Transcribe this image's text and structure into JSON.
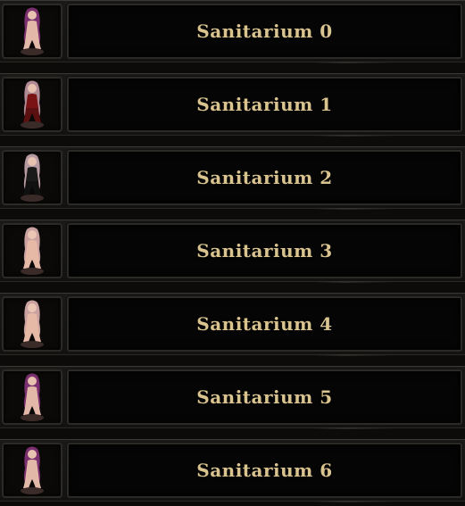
{
  "saves": [
    {
      "label": "Sanitarium 0",
      "portrait_icon": "character-portrait-icon",
      "hair_color": "#7a2f6e",
      "outfit_color": "#e2b8a8"
    },
    {
      "label": "Sanitarium 1",
      "portrait_icon": "character-portrait-icon",
      "hair_color": "#b08a95",
      "outfit_color": "#7a1414"
    },
    {
      "label": "Sanitarium 2",
      "portrait_icon": "character-portrait-icon",
      "hair_color": "#b59aa2",
      "outfit_color": "#1a1a1a"
    },
    {
      "label": "Sanitarium 3",
      "portrait_icon": "character-portrait-icon",
      "hair_color": "#c9a1a0",
      "outfit_color": "#e6b9a6"
    },
    {
      "label": "Sanitarium 4",
      "portrait_icon": "character-portrait-icon",
      "hair_color": "#c9a1a0",
      "outfit_color": "#e6b9a6"
    },
    {
      "label": "Sanitarium 5",
      "portrait_icon": "character-portrait-icon",
      "hair_color": "#7a2f6e",
      "outfit_color": "#e2b8a8"
    },
    {
      "label": "Sanitarium 6",
      "portrait_icon": "character-portrait-icon",
      "hair_color": "#7a2f6e",
      "outfit_color": "#e2b8a8"
    }
  ],
  "colors": {
    "label": "#d9c38f",
    "frame": "#2c2a27",
    "button_bg": "#050505"
  }
}
